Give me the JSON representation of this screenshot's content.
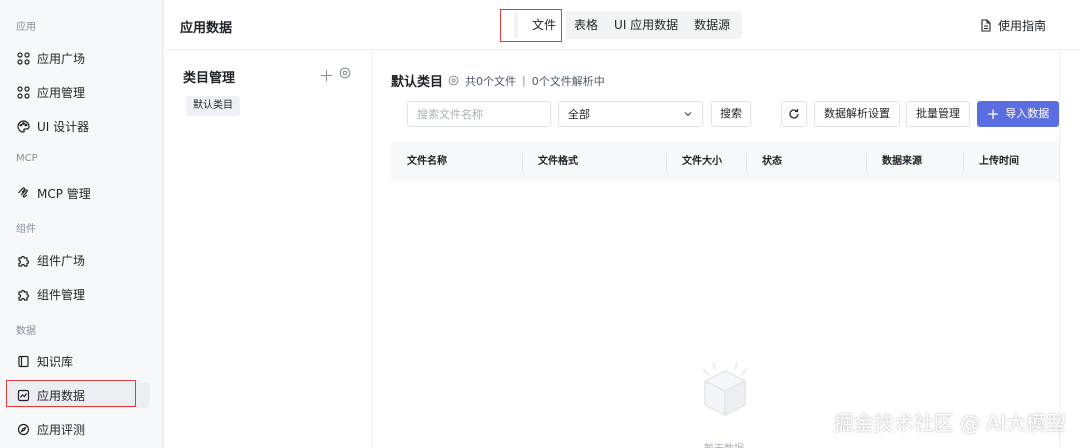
{
  "sidebar": {
    "sections": [
      {
        "title": "应用",
        "items": [
          {
            "label": "应用广场",
            "icon": "grid-icon"
          },
          {
            "label": "应用管理",
            "icon": "grid-icon"
          },
          {
            "label": "UI 设计器",
            "icon": "palette-icon"
          }
        ]
      },
      {
        "title": "MCP",
        "items": [
          {
            "label": "MCP 管理",
            "icon": "mcp-icon"
          }
        ]
      },
      {
        "title": "组件",
        "items": [
          {
            "label": "组件广场",
            "icon": "puzzle-icon"
          },
          {
            "label": "组件管理",
            "icon": "puzzle-icon"
          }
        ]
      },
      {
        "title": "数据",
        "items": [
          {
            "label": "知识库",
            "icon": "book-icon"
          },
          {
            "label": "应用数据",
            "icon": "chart-icon",
            "active": true
          },
          {
            "label": "应用评测",
            "icon": "compass-icon"
          }
        ]
      }
    ]
  },
  "header": {
    "title": "应用数据",
    "tabs": [
      {
        "label": "文件",
        "active": true
      },
      {
        "label": "表格"
      },
      {
        "label": "UI 应用数据"
      },
      {
        "label": "数据源"
      }
    ],
    "guide_label": "使用指南"
  },
  "category_panel": {
    "title": "类目管理",
    "items": [
      "默认类目"
    ]
  },
  "content": {
    "title": "默认类目",
    "file_count": "共0个文件",
    "separator": "|",
    "parsing_count": "0个文件解析中",
    "search": {
      "placeholder": "搜索文件名称",
      "value": ""
    },
    "filter_select": {
      "value": "全部"
    },
    "search_button": "搜索",
    "parse_settings_button": "数据解析设置",
    "batch_manage_button": "批量管理",
    "import_button": "导入数据",
    "table": {
      "columns": [
        "文件名称",
        "文件格式",
        "文件大小",
        "状态",
        "数据来源",
        "上传时间"
      ],
      "rows": []
    },
    "empty_text": "暂无数据"
  },
  "watermark": "掘金技术社区 @ AI大模型",
  "colors": {
    "primary": "#5b6ee1",
    "annotation": "#e03a3a",
    "sidebar_bg": "#f7f8fa"
  }
}
